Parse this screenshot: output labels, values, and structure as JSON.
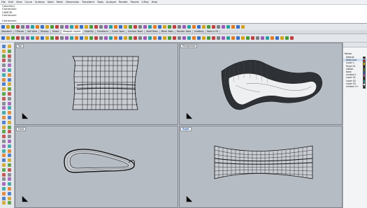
{
  "menu": [
    "File",
    "Edit",
    "View",
    "Curve",
    "Surface",
    "Solid",
    "Mesh",
    "Dimension",
    "Transform",
    "Tools",
    "Analyze",
    "Render",
    "Panels",
    "V-Ray",
    "Help"
  ],
  "command_history": [
    "Cancel(s)",
    "Command:",
    "",
    "CANCEL",
    "Command:"
  ],
  "command_prompt": "Command:",
  "toolbar_tabs": [
    {
      "label": "Standard",
      "active": false
    },
    {
      "label": "CPlanes",
      "active": false
    },
    {
      "label": "Set View",
      "active": false
    },
    {
      "label": "Display",
      "active": false
    },
    {
      "label": "Select",
      "active": false
    },
    {
      "label": "Viewport Layout",
      "active": true
    },
    {
      "label": "Visibility",
      "active": false
    },
    {
      "label": "Transform",
      "active": false
    },
    {
      "label": "Curve Tools",
      "active": false
    },
    {
      "label": "Surface Tools",
      "active": false
    },
    {
      "label": "Solid Tools",
      "active": false
    },
    {
      "label": "Mesh Tools",
      "active": false
    },
    {
      "label": "Render Tools",
      "active": false
    },
    {
      "label": "Drafting",
      "active": false
    },
    {
      "label": "New in V5",
      "active": false
    }
  ],
  "viewports": {
    "top": {
      "title": "Top"
    },
    "perspective": {
      "title": "Perspective"
    },
    "front": {
      "title": "Front"
    },
    "right": {
      "title": "Right"
    }
  },
  "layers_panel": {
    "column_header": "Name",
    "layers": [
      {
        "name": "Default",
        "color": "#111111",
        "selected": false
      },
      {
        "name": "deep end",
        "color": "#d42a2a",
        "selected": true
      },
      {
        "name": "Layer 1",
        "color": "#d4b100",
        "selected": false
      },
      {
        "name": "Panel 01",
        "color": "#222222",
        "selected": false
      },
      {
        "name": "visible",
        "color": "#2a8a2a",
        "selected": false
      },
      {
        "name": "base",
        "color": "#2a55c4",
        "selected": false
      },
      {
        "name": "contour1",
        "color": "#c44fc4",
        "selected": false
      },
      {
        "name": "Layer 01",
        "color": "#222222",
        "selected": false
      },
      {
        "name": "Layer 02",
        "color": "#2a8a8a",
        "selected": false
      },
      {
        "name": "Layer 03",
        "color": "#ffffff",
        "selected": false
      },
      {
        "name": "contour 2+",
        "color": "#222222",
        "selected": false
      }
    ]
  },
  "colors": {
    "viewport_bg": "#b6bcc4",
    "active_viewport_label": "#1a4fa0"
  }
}
